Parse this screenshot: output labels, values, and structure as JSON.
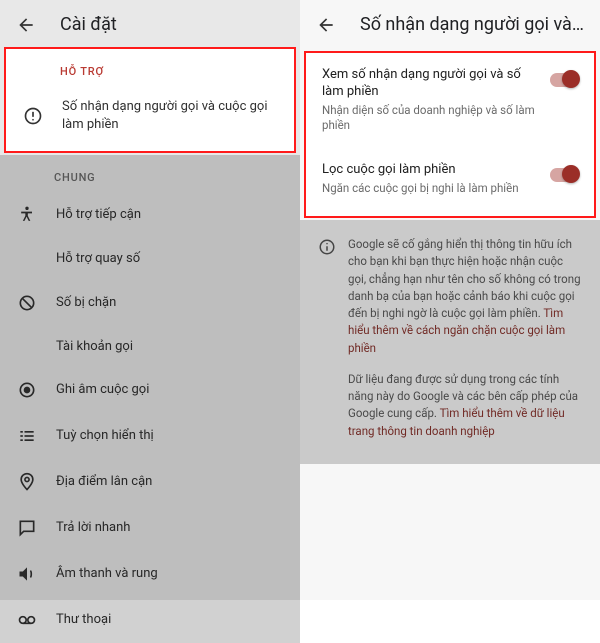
{
  "left": {
    "title": "Cài đặt",
    "support_label": "HỖ TRỢ",
    "support_item": "Số nhận dạng người gọi và cuộc gọi làm phiền",
    "general_label": "CHUNG",
    "items": [
      "Hỗ trợ tiếp cận",
      "Hỗ trợ quay số",
      "Số bị chặn",
      "Tài khoản gọi",
      "Ghi âm cuộc gọi",
      "Tuỳ chọn hiển thị",
      "Địa điểm lân cận",
      "Trả lời nhanh",
      "Âm thanh và rung",
      "Thư thoại"
    ]
  },
  "right": {
    "title": "Số nhận dạng người gọi và cuộ...",
    "settings": [
      {
        "title": "Xem số nhận dạng người gọi và số làm phiền",
        "sub": "Nhận diện số của doanh nghiệp và số làm phiền"
      },
      {
        "title": "Lọc cuộc gọi làm phiền",
        "sub": "Ngăn các cuộc gọi bị nghi là làm phiền"
      }
    ],
    "info1a": "Google sẽ cố gắng hiển thị thông tin hữu ích cho bạn khi bạn thực hiện hoặc nhận cuộc gọi, chẳng hạn như tên cho số không có trong danh bạ của bạn hoặc cảnh báo khi cuộc gọi đến bị nghi ngờ là cuộc gọi làm phiền. ",
    "info1b": "Tìm hiểu thêm về cách ngăn chặn cuộc gọi làm phiền",
    "info2a": "Dữ liệu đang được sử dụng trong các tính năng này do Google và các bên cấp phép của Google cung cấp. ",
    "info2b": "Tìm hiểu thêm về dữ liệu trang thông tin doanh nghiệp"
  }
}
